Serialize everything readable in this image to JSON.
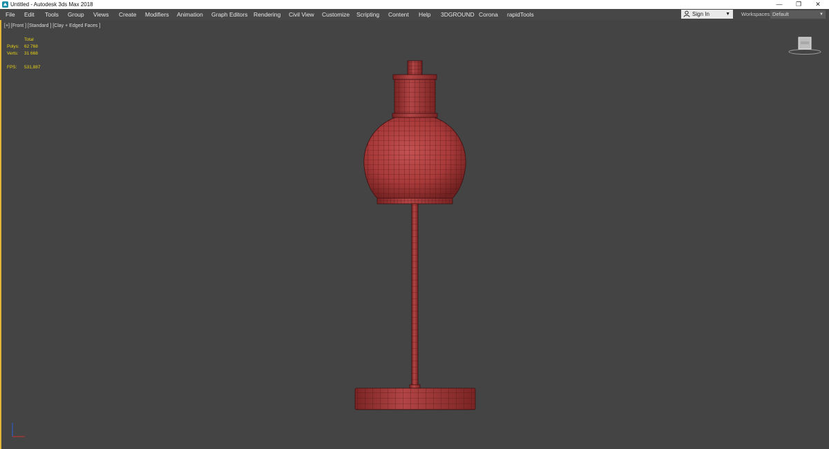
{
  "window": {
    "title": "Untitled - Autodesk 3ds Max 2018",
    "icon": "3ds-max-app-icon",
    "controls": [
      "minimize-icon",
      "restore-icon",
      "close-icon"
    ]
  },
  "menu": {
    "items": [
      "File",
      "Edit",
      "Tools",
      "Group",
      "Views",
      "Create",
      "Modifiers",
      "Animation",
      "Graph Editors",
      "Rendering",
      "Civil View",
      "Customize",
      "Scripting",
      "Content",
      "Help",
      "3DGROUND",
      "Corona",
      "rapidTools"
    ]
  },
  "account": {
    "sign_in": "Sign In"
  },
  "workspaces": {
    "label": "Workspaces:",
    "value": "Default"
  },
  "viewport": {
    "label": "[+] [Front ] [Standard ] [Clay + Edged Faces ]",
    "stats": {
      "header": "Total",
      "polys_label": "Polys:",
      "polys_value": "62 768",
      "verts_label": "Verts:",
      "verts_value": "31 668",
      "fps_label": "FPS:",
      "fps_value": "531,887"
    },
    "model": "lamp",
    "model_color": "#a83a3a",
    "wire_color": "#5a1616",
    "background": "#444444",
    "active_border_color": "#e3b63a"
  }
}
